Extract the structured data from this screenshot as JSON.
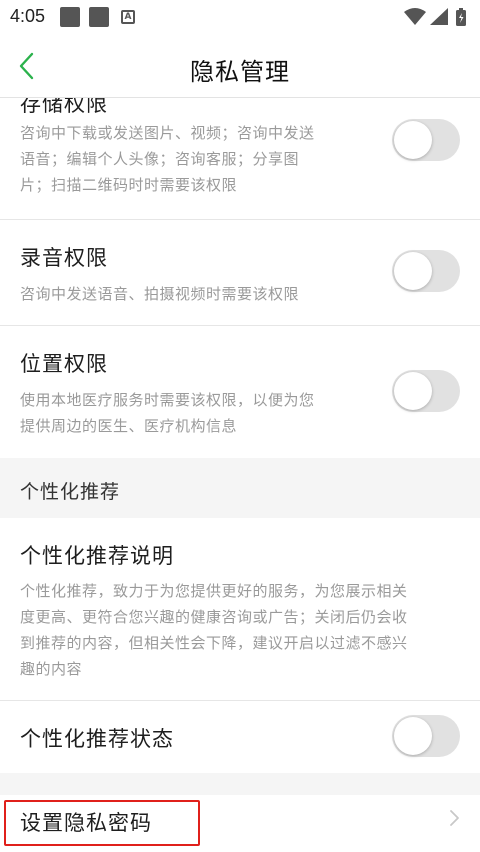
{
  "status_bar": {
    "time": "4:05",
    "notification_letter": "A"
  },
  "header": {
    "title": "隐私管理"
  },
  "settings": {
    "storage": {
      "title": "存储权限",
      "desc_lines": [
        "咨询中下载或发送图片、视频；咨询中发送",
        "语音；编辑个人头像；咨询客服；分享图",
        "片；扫描二维码时时需要该权限"
      ],
      "enabled": false
    },
    "audio": {
      "title": "录音权限",
      "desc": "咨询中发送语音、拍摄视频时需要该权限",
      "enabled": false
    },
    "location": {
      "title": "位置权限",
      "desc_lines": [
        "使用本地医疗服务时需要该权限，以便为您",
        "提供周边的医生、医疗机构信息"
      ],
      "enabled": false
    }
  },
  "personalization": {
    "section_title": "个性化推荐",
    "explain_title": "个性化推荐说明",
    "explain_lines": [
      "个性化推荐，致力于为您提供更好的服务，为您展示相关",
      "度更高、更符合您兴趣的健康咨询或广告；关闭后仍会收",
      "到推荐的内容，但相关性会下降，建议开启以过滤不感兴",
      "趣的内容"
    ],
    "status_title": "个性化推荐状态",
    "status_enabled": false
  },
  "privacy_password": {
    "label": "设置隐私密码"
  },
  "colors": {
    "accent_green": "#2bb24c",
    "highlight_red": "#e0201b",
    "toggle_off": "#e1e1e1"
  }
}
